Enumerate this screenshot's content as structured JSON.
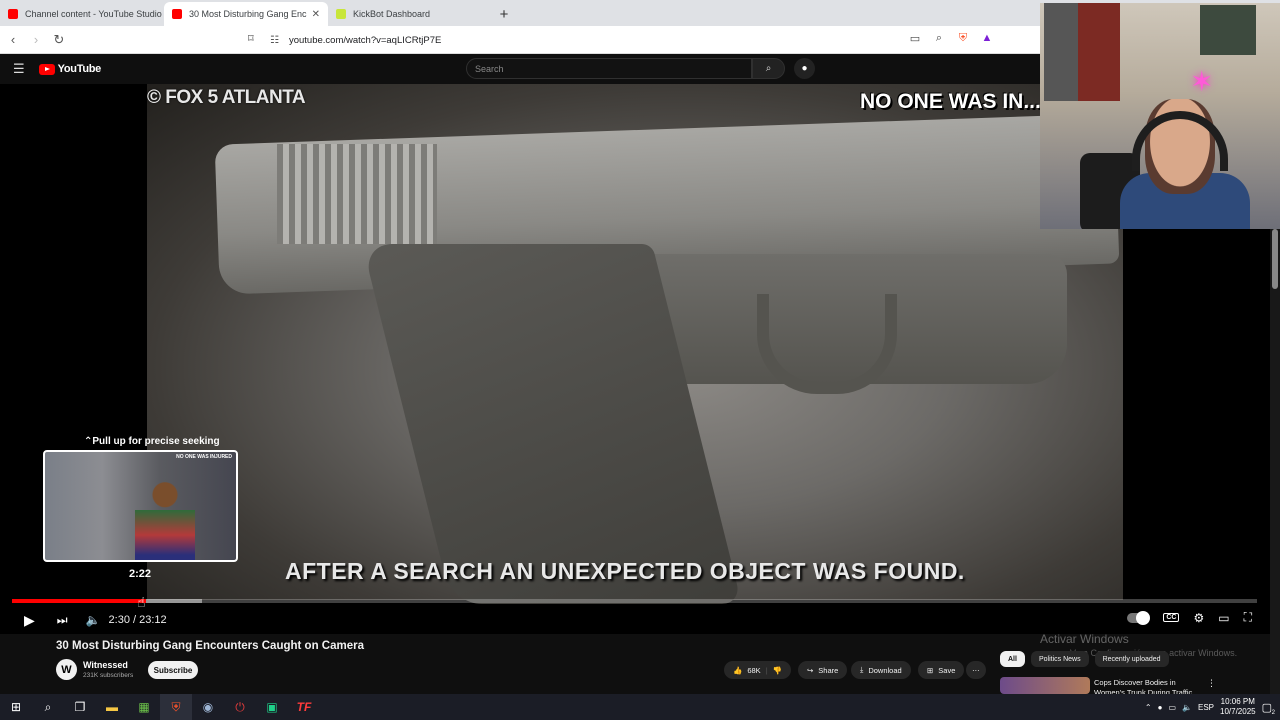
{
  "browser": {
    "tabs": [
      {
        "title": "Channel content - YouTube Studio",
        "active": false,
        "color": "#ff0000"
      },
      {
        "title": "30 Most Disturbing Gang Enc",
        "active": true,
        "color": "#ff0000"
      },
      {
        "title": "KickBot Dashboard",
        "active": false,
        "color": "#53fc18"
      }
    ],
    "url": "youtube.com/watch?v=aqLICRtjP7E"
  },
  "youtube": {
    "logo_text": "YouTube",
    "search_placeholder": "Search"
  },
  "video": {
    "watermark": "© FOX 5 ATLANTA",
    "top_caption": "NO ONE WAS IN...",
    "bottom_caption": "AFTER A SEARCH AN UNEXPECTED OBJECT WAS FOUND.",
    "seek_hint": "Pull up for precise seeking",
    "preview_time": "2:22",
    "preview_tag": "NO ONE WAS INJURED",
    "time_display": "2:30 / 23:12",
    "progress": {
      "played_fraction": 0.108,
      "buffered_fraction": 0.153
    }
  },
  "details": {
    "title": "30 Most Disturbing Gang Encounters Caught on Camera",
    "channel_initial": "W",
    "channel_name": "Witnessed",
    "subscribers": "231K subscribers",
    "subscribe_label": "Subscribe",
    "likes": "68K",
    "share_label": "Share",
    "download_label": "Download",
    "save_label": "Save"
  },
  "sidebar": {
    "chips": [
      "All",
      "Politics News",
      "Recently uploaded"
    ],
    "rec_title": "Cops Discover Bodies in Women's Trunk During Traffic..."
  },
  "overlay": {
    "activate_title": "Activar Windows",
    "activate_sub": "Ve a Configuración para activar Windows."
  },
  "taskbar": {
    "lang": "ESP",
    "time": "10:06 PM",
    "date": "10/7/2025",
    "notif_count": "2"
  }
}
